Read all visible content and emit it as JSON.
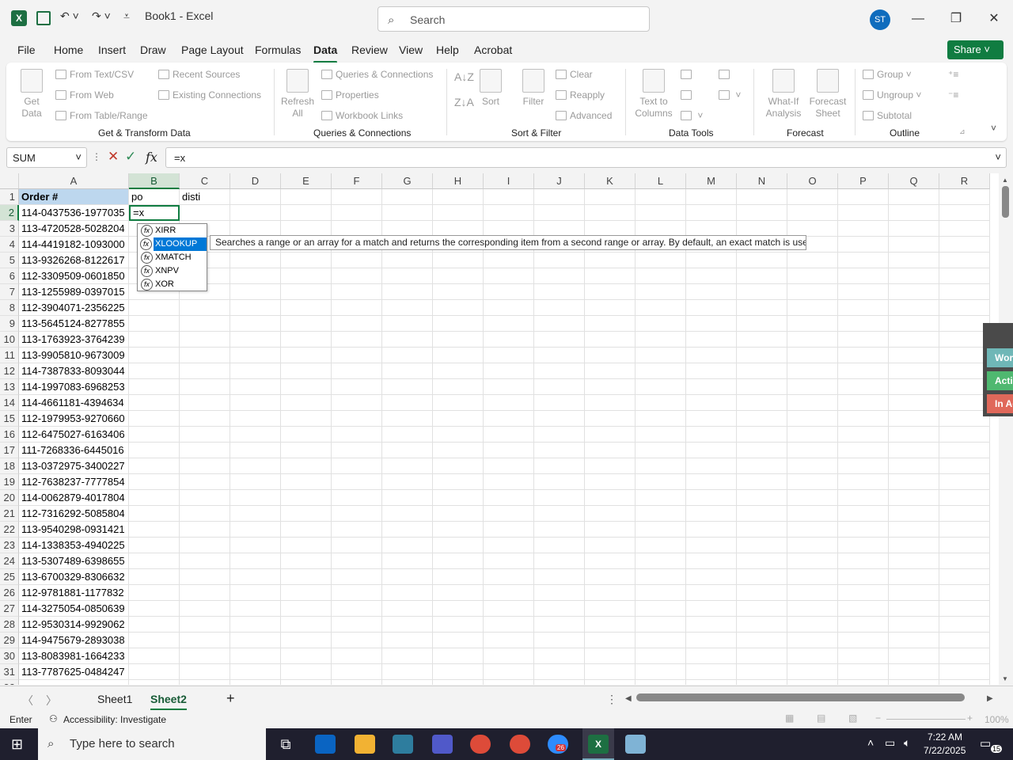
{
  "window": {
    "title": "Book1 - Excel",
    "search_placeholder": "Search",
    "avatar_initials": "ST",
    "app_icon": "X"
  },
  "menu": [
    "File",
    "Home",
    "Insert",
    "Draw",
    "Page Layout",
    "Formulas",
    "Data",
    "Review",
    "View",
    "Help",
    "Acrobat"
  ],
  "active_menu": "Data",
  "share_label": "Share",
  "ribbon": {
    "get_data": "Get\nData",
    "from_text_csv": "From Text/CSV",
    "from_web": "From Web",
    "from_table_range": "From Table/Range",
    "recent_sources": "Recent Sources",
    "existing_connections": "Existing Connections",
    "group_get_transform": "Get & Transform Data",
    "refresh_all": "Refresh\nAll",
    "queries_connections": "Queries & Connections",
    "properties": "Properties",
    "workbook_links": "Workbook Links",
    "group_queries": "Queries & Connections",
    "sort": "Sort",
    "filter": "Filter",
    "clear": "Clear",
    "reapply": "Reapply",
    "advanced": "Advanced",
    "group_sort_filter": "Sort & Filter",
    "text_to_columns": "Text to\nColumns",
    "group_data_tools": "Data Tools",
    "what_if": "What-If\nAnalysis",
    "forecast_sheet": "Forecast\nSheet",
    "group_forecast": "Forecast",
    "group_btn": "Group",
    "ungroup_btn": "Ungroup",
    "subtotal": "Subtotal",
    "group_outline": "Outline"
  },
  "name_box": "SUM",
  "formula": "=x",
  "columns": [
    "A",
    "B",
    "C",
    "D",
    "E",
    "F",
    "G",
    "H",
    "I",
    "J",
    "K",
    "L",
    "M",
    "N",
    "O",
    "P",
    "Q",
    "R"
  ],
  "header_row": {
    "A": "Order #",
    "B": "po",
    "C": "disti"
  },
  "active_cell_value": "=x",
  "orders": [
    "114-0437536-1977035",
    "113-4720528-5028204",
    "114-4419182-1093000",
    "113-9326268-8122617",
    "112-3309509-0601850",
    "113-1255989-0397015",
    "112-3904071-2356225",
    "113-5645124-8277855",
    "113-1763923-3764239",
    "113-9905810-9673009",
    "114-7387833-8093044",
    "114-1997083-6968253",
    "114-4661181-4394634",
    "112-1979953-9270660",
    "112-6475027-6163406",
    "111-7268336-6445016",
    "113-0372975-3400227",
    "112-7638237-7777854",
    "114-0062879-4017804",
    "112-7316292-5085804",
    "113-9540298-0931421",
    "114-1338353-4940225",
    "113-5307489-6398655",
    "113-6700329-8306632",
    "112-9781881-1177832",
    "114-3275054-0850639",
    "112-9530314-9929062",
    "114-9475679-2893038",
    "113-8083981-1664233",
    "113-7787625-0484247"
  ],
  "autocomplete": [
    "XIRR",
    "XLOOKUP",
    "XMATCH",
    "XNPV",
    "XOR"
  ],
  "autocomplete_selected": "XLOOKUP",
  "tooltip": "Searches a range or an array for a match and returns the corresponding item from a second range or array. By default, an exact match is used",
  "side_panel": [
    "Wor",
    "Acti",
    "In Ac"
  ],
  "sheets": [
    "Sheet1",
    "Sheet2"
  ],
  "active_sheet": "Sheet2",
  "status": {
    "mode": "Enter",
    "accessibility": "Accessibility: Investigate",
    "zoom": "100%"
  },
  "taskbar": {
    "search": "Type here to search",
    "time": "7:22 AM",
    "date": "7/22/2025",
    "notifications": "15",
    "outlook_badge": "26"
  }
}
